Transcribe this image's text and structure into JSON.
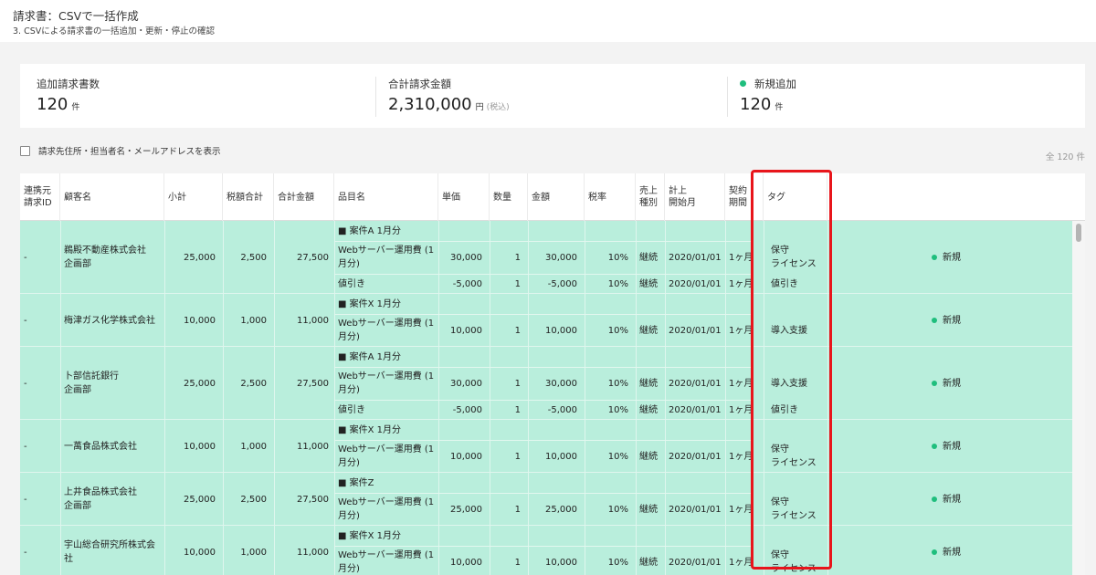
{
  "header": {
    "title": "請求書：CSVで一括作成",
    "subtitle": "3. CSVによる請求書の一括追加・更新・停止の確認"
  },
  "summary": {
    "count": {
      "label": "追加請求書数",
      "value": "120",
      "unit": "件"
    },
    "amount": {
      "label": "合計請求金額",
      "value": "2,310,000",
      "unit": "円",
      "note": "(税込)"
    },
    "new": {
      "label": "新規追加",
      "value": "120",
      "unit": "件",
      "status_color": "#1fbe7d"
    }
  },
  "options": {
    "show_address_label": "請求先住所・担当者名・メールアドレスを表示"
  },
  "total_label": "全 120 件",
  "table": {
    "columns": [
      {
        "l1": "連携元",
        "l2": "請求ID"
      },
      {
        "l1": "顧客名",
        "l2": ""
      },
      {
        "l1": "小計",
        "l2": ""
      },
      {
        "l1": "税額合計",
        "l2": ""
      },
      {
        "l1": "合計金額",
        "l2": ""
      },
      {
        "l1": "品目名",
        "l2": ""
      },
      {
        "l1": "単価",
        "l2": ""
      },
      {
        "l1": "数量",
        "l2": ""
      },
      {
        "l1": "金額",
        "l2": ""
      },
      {
        "l1": "税率",
        "l2": ""
      },
      {
        "l1": "売上",
        "l2": "種別"
      },
      {
        "l1": "計上",
        "l2": "開始月"
      },
      {
        "l1": "契約",
        "l2": "期間"
      },
      {
        "l1": "タグ",
        "l2": ""
      }
    ],
    "groups": [
      {
        "id": "-",
        "customer": "鵜殿不動産株式会社\n企画部",
        "subtotal": "25,000",
        "tax": "2,500",
        "total": "27,500",
        "status": "新規",
        "items": [
          {
            "name": "■ 案件A 1月分",
            "price": "",
            "qty": "",
            "amount": "",
            "rate": "",
            "kind": "",
            "start": "",
            "term": "",
            "tag": ""
          },
          {
            "name": "Webサーバー運用費 (1\n月分)",
            "price": "30,000",
            "qty": "1",
            "amount": "30,000",
            "rate": "10%",
            "kind": "継続",
            "start": "2020/01/01",
            "term": "1ヶ月",
            "tag": "保守\nライセンス"
          },
          {
            "name": "値引き",
            "price": "-5,000",
            "qty": "1",
            "amount": "-5,000",
            "rate": "10%",
            "kind": "継続",
            "start": "2020/01/01",
            "term": "1ヶ月",
            "tag": "値引き"
          }
        ]
      },
      {
        "id": "-",
        "customer": "梅津ガス化学株式会社",
        "subtotal": "10,000",
        "tax": "1,000",
        "total": "11,000",
        "status": "新規",
        "items": [
          {
            "name": "■ 案件X 1月分",
            "price": "",
            "qty": "",
            "amount": "",
            "rate": "",
            "kind": "",
            "start": "",
            "term": "",
            "tag": ""
          },
          {
            "name": "Webサーバー運用費 (1\n月分)",
            "price": "10,000",
            "qty": "1",
            "amount": "10,000",
            "rate": "10%",
            "kind": "継続",
            "start": "2020/01/01",
            "term": "1ヶ月",
            "tag": "導入支援"
          }
        ]
      },
      {
        "id": "-",
        "customer": "卜部信託銀行\n企画部",
        "subtotal": "25,000",
        "tax": "2,500",
        "total": "27,500",
        "status": "新規",
        "items": [
          {
            "name": "■ 案件A 1月分",
            "price": "",
            "qty": "",
            "amount": "",
            "rate": "",
            "kind": "",
            "start": "",
            "term": "",
            "tag": ""
          },
          {
            "name": "Webサーバー運用費 (1\n月分)",
            "price": "30,000",
            "qty": "1",
            "amount": "30,000",
            "rate": "10%",
            "kind": "継続",
            "start": "2020/01/01",
            "term": "1ヶ月",
            "tag": "導入支援"
          },
          {
            "name": "値引き",
            "price": "-5,000",
            "qty": "1",
            "amount": "-5,000",
            "rate": "10%",
            "kind": "継続",
            "start": "2020/01/01",
            "term": "1ヶ月",
            "tag": "値引き"
          }
        ]
      },
      {
        "id": "-",
        "customer": "一萬食品株式会社",
        "subtotal": "10,000",
        "tax": "1,000",
        "total": "11,000",
        "status": "新規",
        "items": [
          {
            "name": "■ 案件X 1月分",
            "price": "",
            "qty": "",
            "amount": "",
            "rate": "",
            "kind": "",
            "start": "",
            "term": "",
            "tag": ""
          },
          {
            "name": "Webサーバー運用費 (1\n月分)",
            "price": "10,000",
            "qty": "1",
            "amount": "10,000",
            "rate": "10%",
            "kind": "継続",
            "start": "2020/01/01",
            "term": "1ヶ月",
            "tag": "保守\nライセンス"
          }
        ]
      },
      {
        "id": "-",
        "customer": "上井食品株式会社\n企画部",
        "subtotal": "25,000",
        "tax": "2,500",
        "total": "27,500",
        "status": "新規",
        "items": [
          {
            "name": "■ 案件Z",
            "price": "",
            "qty": "",
            "amount": "",
            "rate": "",
            "kind": "",
            "start": "",
            "term": "",
            "tag": ""
          },
          {
            "name": "Webサーバー運用費 (1\n月分)",
            "price": "25,000",
            "qty": "1",
            "amount": "25,000",
            "rate": "10%",
            "kind": "継続",
            "start": "2020/01/01",
            "term": "1ヶ月",
            "tag": "保守\nライセンス"
          }
        ]
      },
      {
        "id": "-",
        "customer": "宇山総合研究所株式会\n社",
        "subtotal": "10,000",
        "tax": "1,000",
        "total": "11,000",
        "status": "新規",
        "items": [
          {
            "name": "■ 案件X 1月分",
            "price": "",
            "qty": "",
            "amount": "",
            "rate": "",
            "kind": "",
            "start": "",
            "term": "",
            "tag": ""
          },
          {
            "name": "Webサーバー運用費 (1\n月分)",
            "price": "10,000",
            "qty": "1",
            "amount": "10,000",
            "rate": "10%",
            "kind": "継続",
            "start": "2020/01/01",
            "term": "1ヶ月",
            "tag": "保守\nライセンス"
          }
        ]
      }
    ]
  },
  "colors": {
    "row_new": "#b9eedc",
    "accent_green": "#1fbe7d",
    "highlight": "#e8151b"
  }
}
